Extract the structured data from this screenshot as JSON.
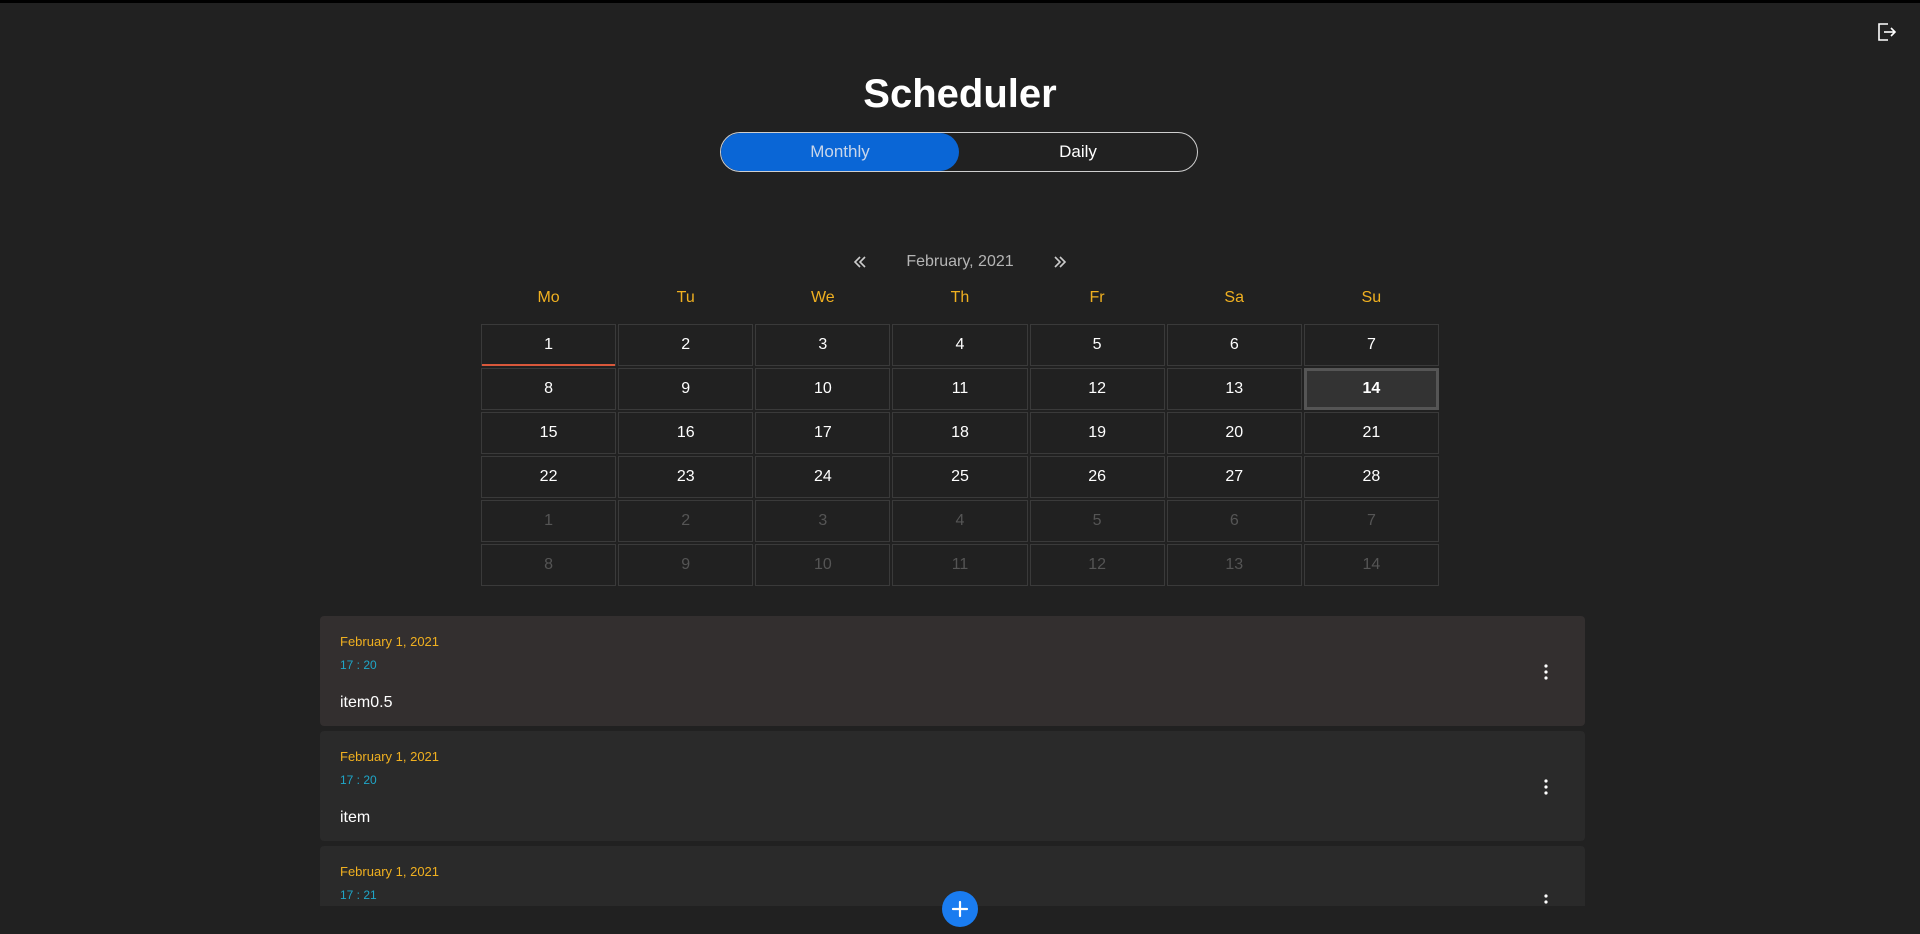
{
  "app": {
    "title": "Scheduler"
  },
  "toggle": {
    "monthly": "Monthly",
    "daily": "Daily",
    "active": "monthly"
  },
  "calendar": {
    "month_label": "February, 2021",
    "weekdays": [
      "Mo",
      "Tu",
      "We",
      "Th",
      "Fr",
      "Sa",
      "Su"
    ],
    "days": [
      {
        "n": "1",
        "other": false,
        "today": true,
        "selected": false
      },
      {
        "n": "2",
        "other": false
      },
      {
        "n": "3",
        "other": false
      },
      {
        "n": "4",
        "other": false
      },
      {
        "n": "5",
        "other": false
      },
      {
        "n": "6",
        "other": false
      },
      {
        "n": "7",
        "other": false
      },
      {
        "n": "8",
        "other": false
      },
      {
        "n": "9",
        "other": false
      },
      {
        "n": "10",
        "other": false
      },
      {
        "n": "11",
        "other": false
      },
      {
        "n": "12",
        "other": false
      },
      {
        "n": "13",
        "other": false
      },
      {
        "n": "14",
        "other": false,
        "selected": true
      },
      {
        "n": "15",
        "other": false
      },
      {
        "n": "16",
        "other": false
      },
      {
        "n": "17",
        "other": false
      },
      {
        "n": "18",
        "other": false
      },
      {
        "n": "19",
        "other": false
      },
      {
        "n": "20",
        "other": false
      },
      {
        "n": "21",
        "other": false
      },
      {
        "n": "22",
        "other": false
      },
      {
        "n": "23",
        "other": false
      },
      {
        "n": "24",
        "other": false
      },
      {
        "n": "25",
        "other": false
      },
      {
        "n": "26",
        "other": false
      },
      {
        "n": "27",
        "other": false
      },
      {
        "n": "28",
        "other": false
      },
      {
        "n": "1",
        "other": true
      },
      {
        "n": "2",
        "other": true
      },
      {
        "n": "3",
        "other": true
      },
      {
        "n": "4",
        "other": true
      },
      {
        "n": "5",
        "other": true
      },
      {
        "n": "6",
        "other": true
      },
      {
        "n": "7",
        "other": true
      },
      {
        "n": "8",
        "other": true
      },
      {
        "n": "9",
        "other": true
      },
      {
        "n": "10",
        "other": true
      },
      {
        "n": "11",
        "other": true
      },
      {
        "n": "12",
        "other": true
      },
      {
        "n": "13",
        "other": true
      },
      {
        "n": "14",
        "other": true
      }
    ]
  },
  "events": [
    {
      "date": "February 1, 2021",
      "time": "17 : 20",
      "name": "item0.5"
    },
    {
      "date": "February 1, 2021",
      "time": "17 : 20",
      "name": "item"
    },
    {
      "date": "February 1, 2021",
      "time": "17 : 21",
      "name": ""
    }
  ],
  "colors": {
    "accent": "#0a66d6",
    "weekday": "#f0b020",
    "time": "#1fa6c8",
    "today_marker": "#d9583b",
    "fab": "#1a7cf0"
  },
  "icons": {
    "logout": "logout-icon",
    "prev": "double-chevron-left-icon",
    "next": "double-chevron-right-icon",
    "menu": "more-vertical-icon",
    "add": "plus-icon"
  }
}
